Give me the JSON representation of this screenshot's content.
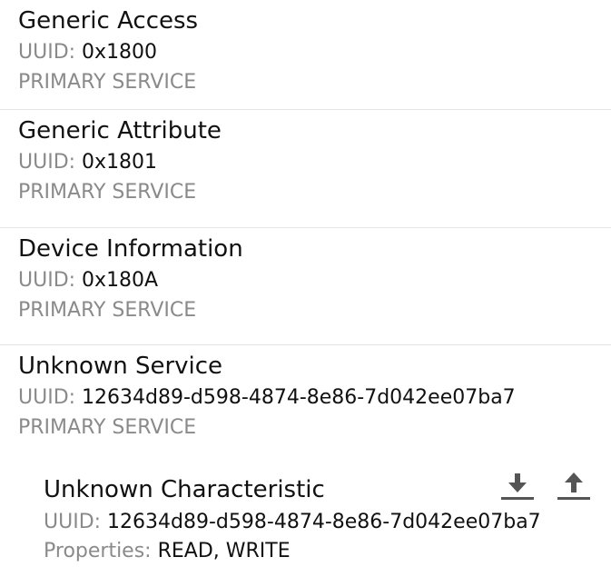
{
  "services": [
    {
      "name": "Generic Access",
      "uuid_label": "UUID:",
      "uuid": "0x1800",
      "type": "PRIMARY SERVICE"
    },
    {
      "name": "Generic Attribute",
      "uuid_label": "UUID:",
      "uuid": "0x1801",
      "type": "PRIMARY SERVICE"
    },
    {
      "name": "Device Information",
      "uuid_label": "UUID:",
      "uuid": "0x180A",
      "type": "PRIMARY SERVICE"
    },
    {
      "name": "Unknown Service",
      "uuid_label": "UUID:",
      "uuid": "12634d89-d598-4874-8e86-7d042ee07ba7",
      "type": "PRIMARY SERVICE",
      "characteristic": {
        "name": "Unknown Characteristic",
        "uuid_label": "UUID:",
        "uuid": "12634d89-d598-4874-8e86-7d042ee07ba7",
        "properties_label": "Properties:",
        "properties": "READ, WRITE",
        "read_icon": "download-icon",
        "write_icon": "upload-icon"
      }
    }
  ],
  "colors": {
    "primary_text": "#111111",
    "secondary_text": "#8a8a8a",
    "divider": "#e4e4e4",
    "icon": "#555555"
  }
}
